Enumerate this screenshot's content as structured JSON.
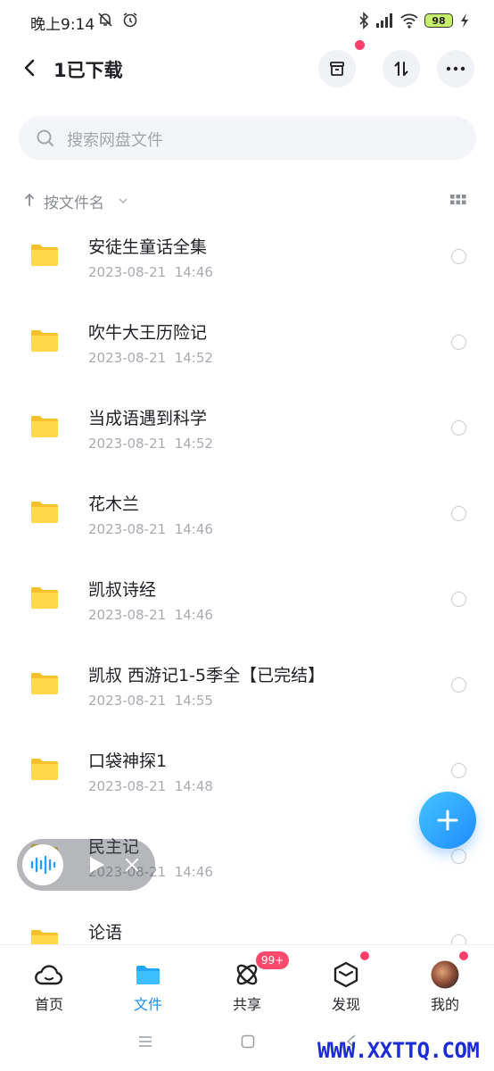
{
  "status_bar": {
    "time": "晚上9:14",
    "battery": "98"
  },
  "header": {
    "title": "1已下载"
  },
  "search": {
    "placeholder": "搜索网盘文件"
  },
  "sort": {
    "label": "按文件名"
  },
  "files": [
    {
      "name": "安徒生童话全集",
      "date": "2023-08-21  14:46"
    },
    {
      "name": "吹牛大王历险记",
      "date": "2023-08-21  14:52"
    },
    {
      "name": "当成语遇到科学",
      "date": "2023-08-21  14:52"
    },
    {
      "name": "花木兰",
      "date": "2023-08-21  14:46"
    },
    {
      "name": "凯叔诗经",
      "date": "2023-08-21  14:46"
    },
    {
      "name": "凯叔 西游记1-5季全【已完结】",
      "date": "2023-08-21  14:55"
    },
    {
      "name": "口袋神探1",
      "date": "2023-08-21  14:48"
    },
    {
      "name": "民主记",
      "date": "2023-08-21  14:46"
    },
    {
      "name": "论语",
      "date": ""
    }
  ],
  "tabs": [
    {
      "label": "首页",
      "icon": "cloud-home-icon"
    },
    {
      "label": "文件",
      "icon": "folder-icon"
    },
    {
      "label": "共享",
      "icon": "share-atom-icon"
    },
    {
      "label": "发现",
      "icon": "discover-box-icon"
    },
    {
      "label": "我的",
      "icon": "avatar"
    }
  ],
  "share_badge": "99+",
  "watermark": "WWW.XXTTQ.COM",
  "colors": {
    "accent": "#1d8ff3",
    "folder": "#ffd740",
    "badge": "#ff4a6e"
  }
}
